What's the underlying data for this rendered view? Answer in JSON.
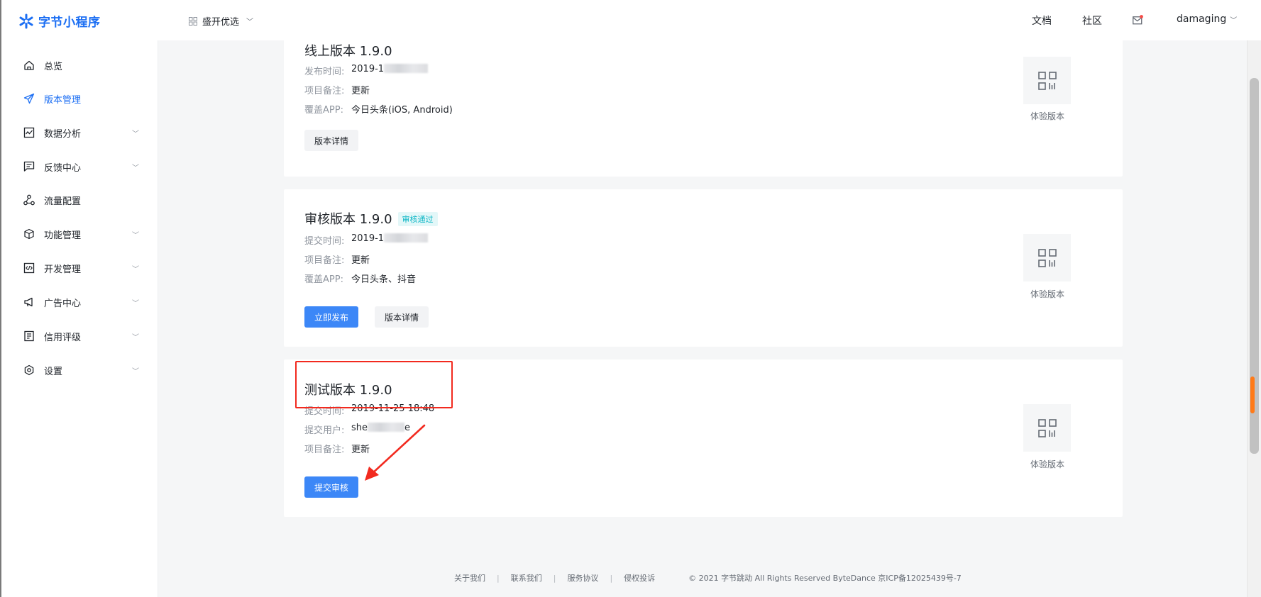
{
  "header": {
    "logo_text": "字节小程序",
    "app_name": "盛开优选",
    "links": {
      "docs": "文档",
      "community": "社区"
    },
    "user_name": "damaging",
    "brand_color": "#1b6ef3",
    "icons": {
      "logo": "bytedance-star-icon",
      "app": "grid-icon",
      "mail": "mail-icon"
    }
  },
  "sidebar": {
    "items": [
      {
        "label": "总览",
        "icon": "home-icon",
        "has_children": false,
        "active": false
      },
      {
        "label": "版本管理",
        "icon": "send-icon",
        "has_children": false,
        "active": true
      },
      {
        "label": "数据分析",
        "icon": "chart-icon",
        "has_children": true,
        "active": false
      },
      {
        "label": "反馈中心",
        "icon": "message-icon",
        "has_children": true,
        "active": false
      },
      {
        "label": "流量配置",
        "icon": "share-icon",
        "has_children": false,
        "active": false
      },
      {
        "label": "功能管理",
        "icon": "cube-icon",
        "has_children": true,
        "active": false
      },
      {
        "label": "开发管理",
        "icon": "code-icon",
        "has_children": true,
        "active": false
      },
      {
        "label": "广告中心",
        "icon": "megaphone-icon",
        "has_children": true,
        "active": false
      },
      {
        "label": "信用评级",
        "icon": "document-icon",
        "has_children": true,
        "active": false
      },
      {
        "label": "设置",
        "icon": "gear-icon",
        "has_children": true,
        "active": false
      }
    ]
  },
  "cards": {
    "online": {
      "title": "线上版本 1.9.0",
      "publish_time_label": "发布时间:",
      "publish_time_value": "2019-1",
      "note_label": "项目备注:",
      "note_value": "更新",
      "apps_label": "覆盖APP:",
      "apps_value": "今日头条(iOS, Android)",
      "detail_button": "版本详情",
      "qr_label": "体验版本"
    },
    "review": {
      "title": "审核版本 1.9.0",
      "badge": "审核通过",
      "submit_time_label": "提交时间:",
      "submit_time_value": "2019-1",
      "note_label": "项目备注:",
      "note_value": "更新",
      "apps_label": "覆盖APP:",
      "apps_value": "今日头条、抖音",
      "publish_button": "立即发布",
      "detail_button": "版本详情",
      "qr_label": "体验版本"
    },
    "test": {
      "title": "测试版本 1.9.0",
      "submit_time_label": "提交时间:",
      "submit_time_value": "2019-11-25 18:48",
      "user_label": "提交用户:",
      "user_value_start": "she",
      "user_value_end": "e",
      "note_label": "项目备注:",
      "note_value": "更新",
      "submit_review_button": "提交审核",
      "qr_label": "体验版本"
    }
  },
  "footer": {
    "links": [
      "关于我们",
      "联系我们",
      "服务协议",
      "侵权投诉"
    ],
    "copyright": "© 2021 字节跳动 All Rights Reserved ByteDance 京ICP备12025439号-7"
  },
  "colors": {
    "primary_button": "#3c87f7",
    "annotation_red": "#f22a1f",
    "badge_text": "#0fb7c6"
  }
}
